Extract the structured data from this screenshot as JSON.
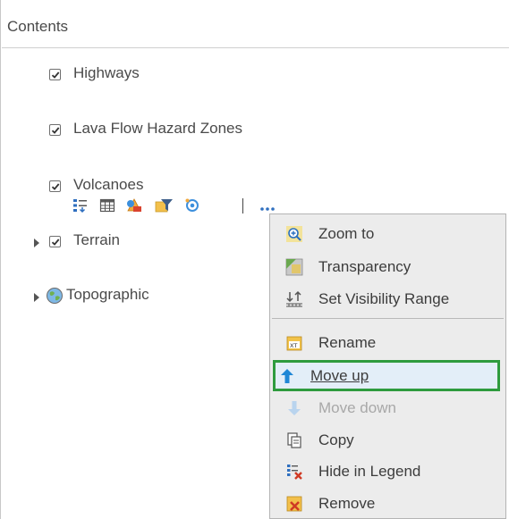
{
  "panel": {
    "title": "Contents"
  },
  "layers": [
    {
      "label": "Highways",
      "checked": true
    },
    {
      "label": "Lava Flow Hazard Zones",
      "checked": true
    },
    {
      "label": "Volcanoes",
      "checked": true
    },
    {
      "label": "Terrain",
      "checked": true
    },
    {
      "label": "Topographic"
    }
  ],
  "layer_tools": [
    "legend-icon",
    "attribute-table-icon",
    "change-style-icon",
    "filter-icon",
    "perform-analysis-icon",
    "more-options-icon"
  ],
  "context_menu": {
    "items": [
      {
        "label": "Zoom to",
        "icon": "zoom-to-icon"
      },
      {
        "label": "Transparency",
        "icon": "transparency-icon"
      },
      {
        "label": "Set Visibility Range",
        "icon": "visibility-range-icon"
      },
      {
        "label": "Rename",
        "icon": "rename-icon"
      },
      {
        "label": "Move up",
        "icon": "arrow-up-icon"
      },
      {
        "label": "Move down",
        "icon": "arrow-down-icon",
        "disabled": true
      },
      {
        "label": "Copy",
        "icon": "copy-icon"
      },
      {
        "label": "Hide in Legend",
        "icon": "hide-in-legend-icon"
      },
      {
        "label": "Remove",
        "icon": "remove-icon"
      }
    ]
  },
  "colors": {
    "highlight_border": "#2e9b3e",
    "highlight_fill": "#e3eef8",
    "menu_background": "#ececec",
    "arrow_blue": "#1f87d6"
  }
}
